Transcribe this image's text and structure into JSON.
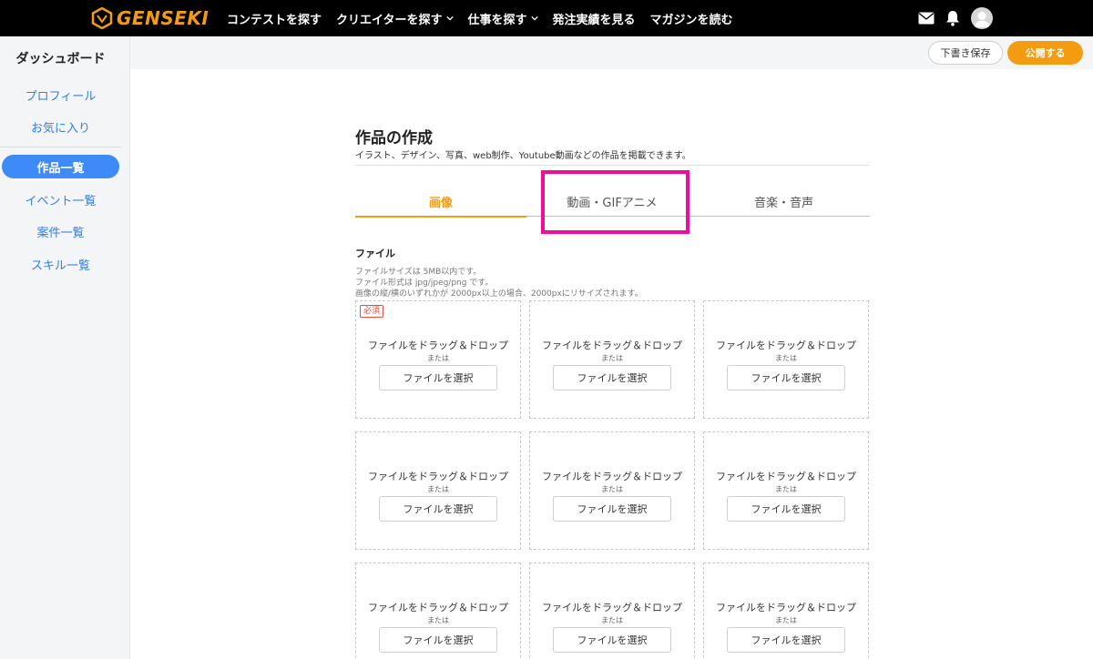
{
  "brand": {
    "name": "GENSEKI",
    "accent": "#f39c12",
    "link": "#2f80ed",
    "highlight": "#f20c9b"
  },
  "nav": {
    "items": [
      {
        "label": "コンテストを探す",
        "dropdown": false
      },
      {
        "label": "クリエイターを探す",
        "dropdown": true
      },
      {
        "label": "仕事を探す",
        "dropdown": true
      },
      {
        "label": "発注実績を見る",
        "dropdown": false
      },
      {
        "label": "マガジンを読む",
        "dropdown": false
      }
    ],
    "icons": [
      "mail-icon",
      "bell-icon",
      "avatar"
    ]
  },
  "sidebar": {
    "title": "ダッシュボード",
    "items": [
      "プロフィール",
      "お気に入り",
      "作品一覧",
      "イベント一覧",
      "案件一覧",
      "スキル一覧"
    ],
    "active": "作品一覧"
  },
  "actions": {
    "draft": "下書き保存",
    "publish": "公開する"
  },
  "main": {
    "title": "作品の作成",
    "description": "イラスト、デザイン、写真、web制作、Youtube動画などの作品を掲載できます。",
    "tabs": [
      "画像",
      "動画・GIFアニメ",
      "音楽・音声"
    ],
    "active_tab": "画像",
    "file": {
      "label": "ファイル",
      "notes": [
        "ファイルサイズは 5MB以内です。",
        "ファイル形式は jpg/jpeg/png です。",
        "画像の縦/横のいずれかが 2000px以上の場合、2000pxにリサイズされます。"
      ],
      "required_badge": "必須",
      "drop_text": "ファイルをドラッグ＆ドロップ",
      "or_text": "または",
      "select_button": "ファイルを選択"
    }
  }
}
